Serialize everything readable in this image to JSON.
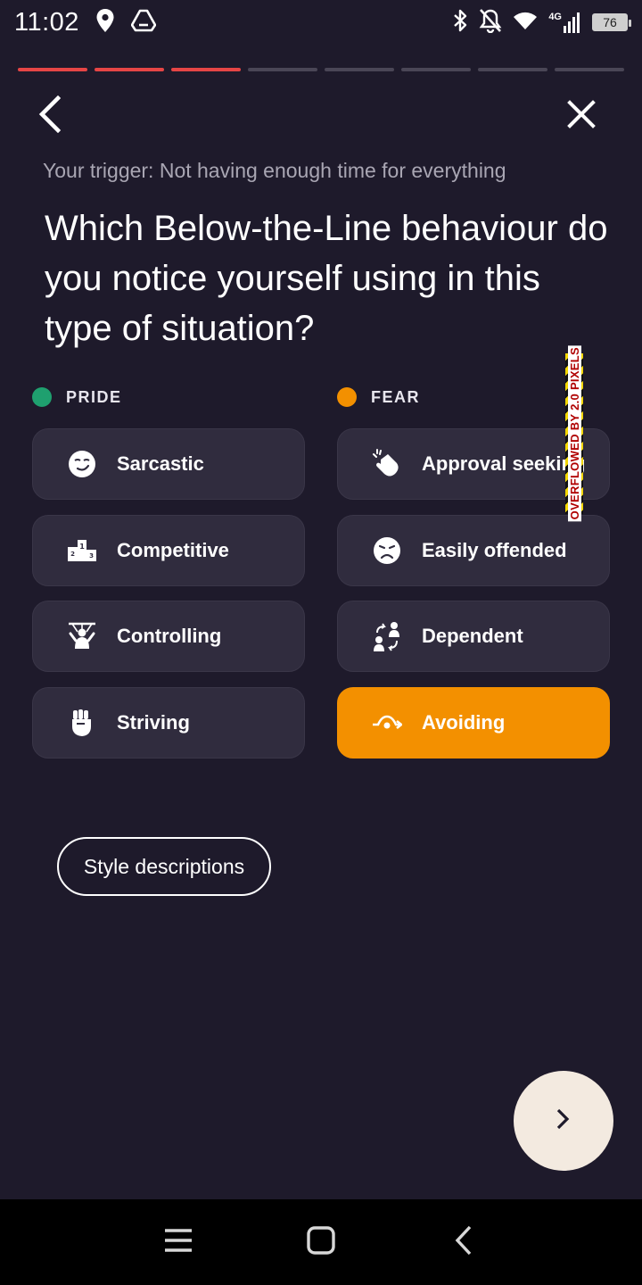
{
  "status_bar": {
    "time": "11:02",
    "network_label": "4G",
    "battery": "76",
    "icons": [
      "location-icon",
      "drive-icon",
      "bluetooth-icon",
      "mute-icon",
      "wifi-icon",
      "signal-icon",
      "battery-icon"
    ]
  },
  "progress": {
    "total_steps": 8,
    "completed_steps": 3,
    "color_done": "#e64545",
    "color_todo": "#4a4656"
  },
  "nav": {
    "back_icon": "chevron-left-icon",
    "close_icon": "close-icon"
  },
  "trigger_text": "Your trigger: Not having enough time for everything",
  "question": "Which Below-the-Line behaviour do you notice yourself using in this type of situation?",
  "columns": {
    "pride": {
      "label": "PRIDE",
      "color": "#1fa06f"
    },
    "fear": {
      "label": "FEAR",
      "color": "#f39000"
    }
  },
  "options": {
    "pride": [
      {
        "label": "Sarcastic",
        "icon": "smirk-face-icon"
      },
      {
        "label": "Competitive",
        "icon": "podium-icon"
      },
      {
        "label": "Controlling",
        "icon": "puppet-icon"
      },
      {
        "label": "Striving",
        "icon": "fist-icon"
      }
    ],
    "fear": [
      {
        "label": "Approval seeking",
        "icon": "clapping-hands-icon"
      },
      {
        "label": "Easily offended",
        "icon": "frown-face-icon"
      },
      {
        "label": "Dependent",
        "icon": "people-exchange-icon"
      },
      {
        "label": "Avoiding",
        "icon": "swerve-arrow-icon",
        "selected": true
      }
    ]
  },
  "overflow_notice": "OVERFLOWED BY 2.0 PIXELS",
  "style_descriptions_label": "Style descriptions",
  "next_button_icon": "chevron-right-icon",
  "accent_selected": "#f39000",
  "system_nav": [
    "menu-icon",
    "home-icon",
    "back-icon"
  ]
}
